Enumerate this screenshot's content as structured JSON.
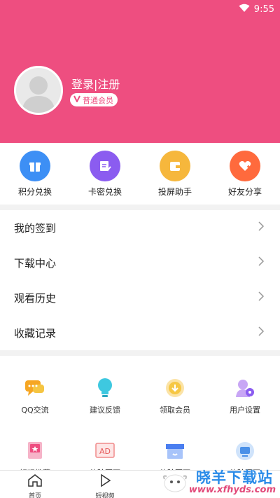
{
  "status_bar": {
    "time": "9:55"
  },
  "profile": {
    "login_text": "登录|注册",
    "member_badge": "普通会员"
  },
  "quick_actions": [
    {
      "label": "积分兑换",
      "icon": "gift-icon",
      "color": "#3d8ff5"
    },
    {
      "label": "卡密兑换",
      "icon": "card-key-icon",
      "color": "#8b5cf0"
    },
    {
      "label": "投屏助手",
      "icon": "wallet-icon",
      "color": "#f6b73c"
    },
    {
      "label": "好友分享",
      "icon": "heart-share-icon",
      "color": "#ff6a3d"
    }
  ],
  "menu_list": [
    {
      "label": "我的签到"
    },
    {
      "label": "下载中心"
    },
    {
      "label": "观看历史"
    },
    {
      "label": "收藏记录"
    }
  ],
  "tools_grid": [
    {
      "label": "QQ交流",
      "icon": "chat-bubble-icon"
    },
    {
      "label": "建议反馈",
      "icon": "lightbulb-icon"
    },
    {
      "label": "领取会员",
      "icon": "coin-download-icon"
    },
    {
      "label": "用户设置",
      "icon": "user-settings-icon"
    },
    {
      "label": "好玩推荐",
      "icon": "recommend-icon"
    },
    {
      "label": "体验页面",
      "icon": "ad-icon"
    },
    {
      "label": "体验页面",
      "icon": "shop-icon"
    },
    {
      "label": "体验页面",
      "icon": "screen-icon"
    }
  ],
  "tab_bar": [
    {
      "label": "首页",
      "icon": "home-icon"
    },
    {
      "label": "短视频",
      "icon": "play-icon"
    }
  ],
  "watermark": {
    "title": "晓羊下载站",
    "url": "www.xfhyds.com"
  },
  "colors": {
    "brand_pink": "#ee4e80",
    "page_bg": "#f2f2f2"
  }
}
